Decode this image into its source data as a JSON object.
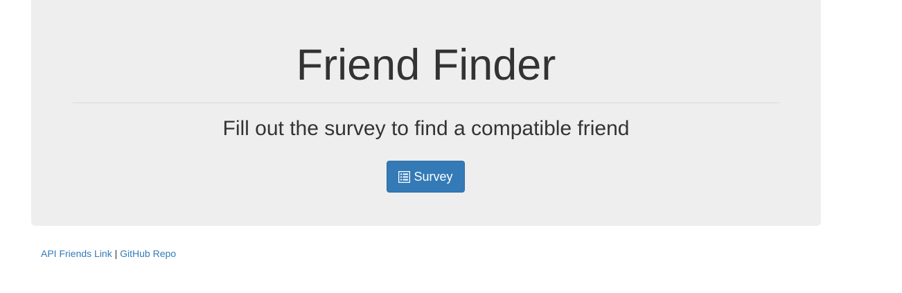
{
  "jumbotron": {
    "title": "Friend Finder",
    "subtitle": "Fill out the survey to find a compatible friend",
    "button": {
      "label": "Survey",
      "icon": "list-alt-icon"
    }
  },
  "footer": {
    "links": [
      {
        "label": "API Friends Link"
      },
      {
        "label": "GitHub Repo"
      }
    ],
    "separator": "|"
  },
  "colors": {
    "jumbotron_bg": "#eeeeee",
    "button_bg": "#337ab7",
    "link": "#337ab7",
    "text": "#333333"
  }
}
